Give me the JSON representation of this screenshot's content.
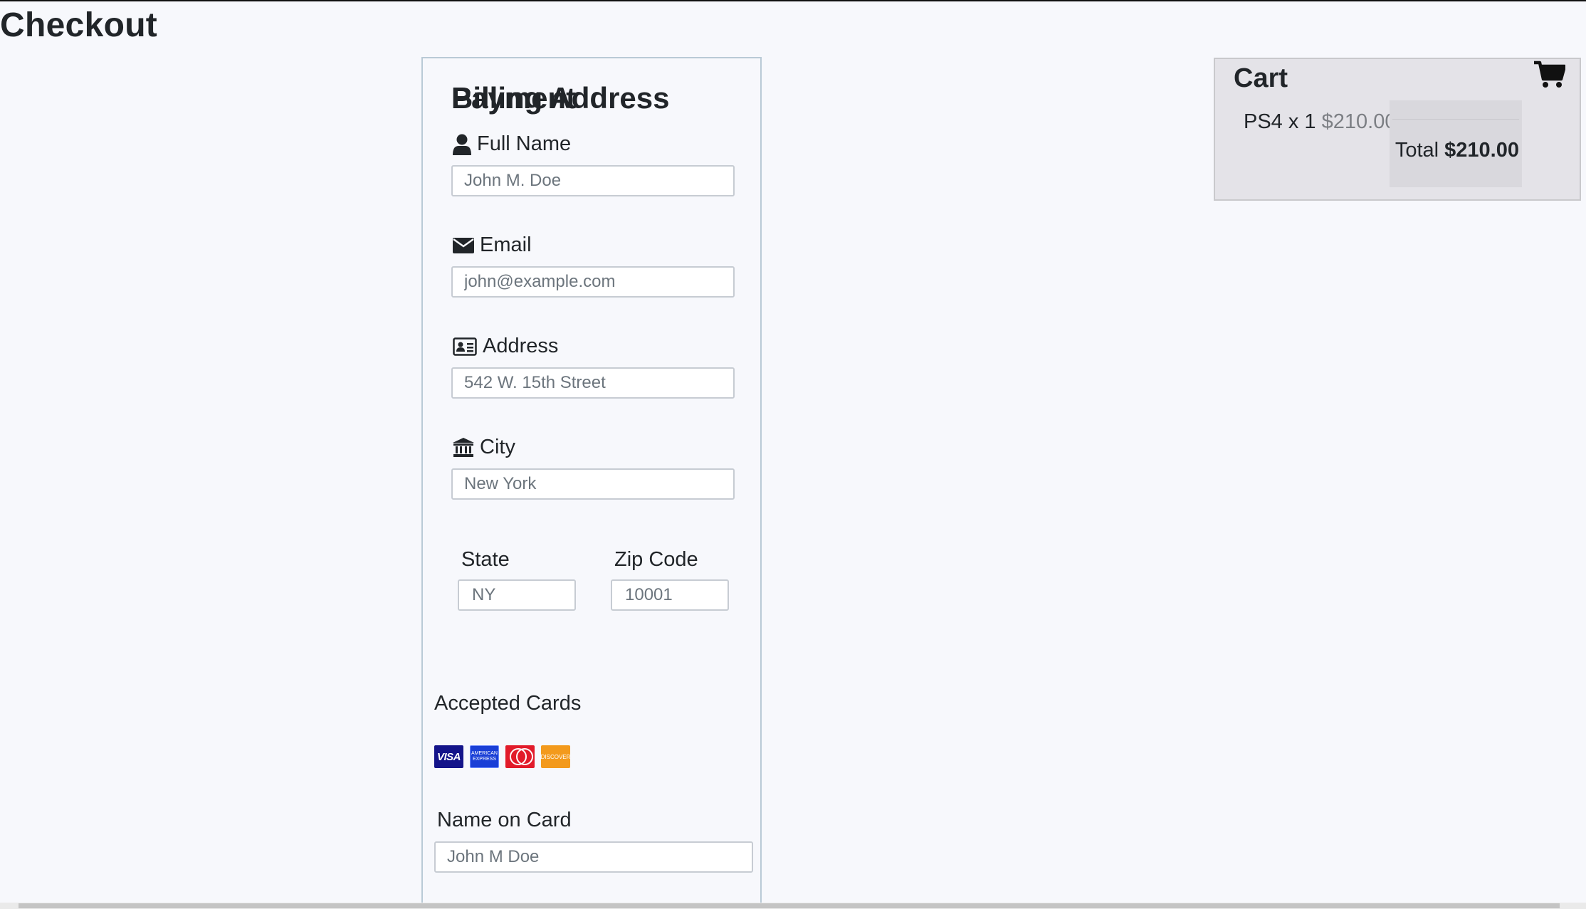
{
  "page": {
    "title": "Checkout"
  },
  "billing": {
    "heading": "Billing Address",
    "full_name": {
      "label": "Full Name",
      "placeholder": "John M. Doe",
      "icon": "user-icon"
    },
    "email": {
      "label": "Email",
      "placeholder": "john@example.com",
      "icon": "envelope-icon"
    },
    "address": {
      "label": "Address",
      "placeholder": "542 W. 15th Street",
      "icon": "address-card-icon"
    },
    "city": {
      "label": "City",
      "placeholder": "New York",
      "icon": "institution-icon"
    },
    "state": {
      "label": "State",
      "placeholder": "NY"
    },
    "zip": {
      "label": "Zip Code",
      "placeholder": "10001"
    }
  },
  "payment": {
    "heading": "Payment",
    "accepted_label": "Accepted Cards",
    "cards": [
      {
        "name": "visa-card-icon",
        "text": "VISA",
        "color": "#14148a"
      },
      {
        "name": "amex-card-icon",
        "text": "AMERICAN EXPRESS",
        "color": "#1a3fd6"
      },
      {
        "name": "mastercard-card-icon",
        "text": "",
        "color": "#e21b2a"
      },
      {
        "name": "discover-card-icon",
        "text": "DISCOVER",
        "color": "#f39a1c"
      }
    ],
    "name_on_card": {
      "label": "Name on Card",
      "placeholder": "John M Doe"
    }
  },
  "cart": {
    "title": "Cart",
    "icon": "shopping-cart-icon",
    "items": [
      {
        "name": "PS4 x 1",
        "price": "$210.00"
      }
    ],
    "total_label": "Total",
    "total_value": "$210.00"
  },
  "colors": {
    "background": "#f7f8fc",
    "panel_border": "#b9cad6",
    "cart_background": "#e4e3e8"
  }
}
